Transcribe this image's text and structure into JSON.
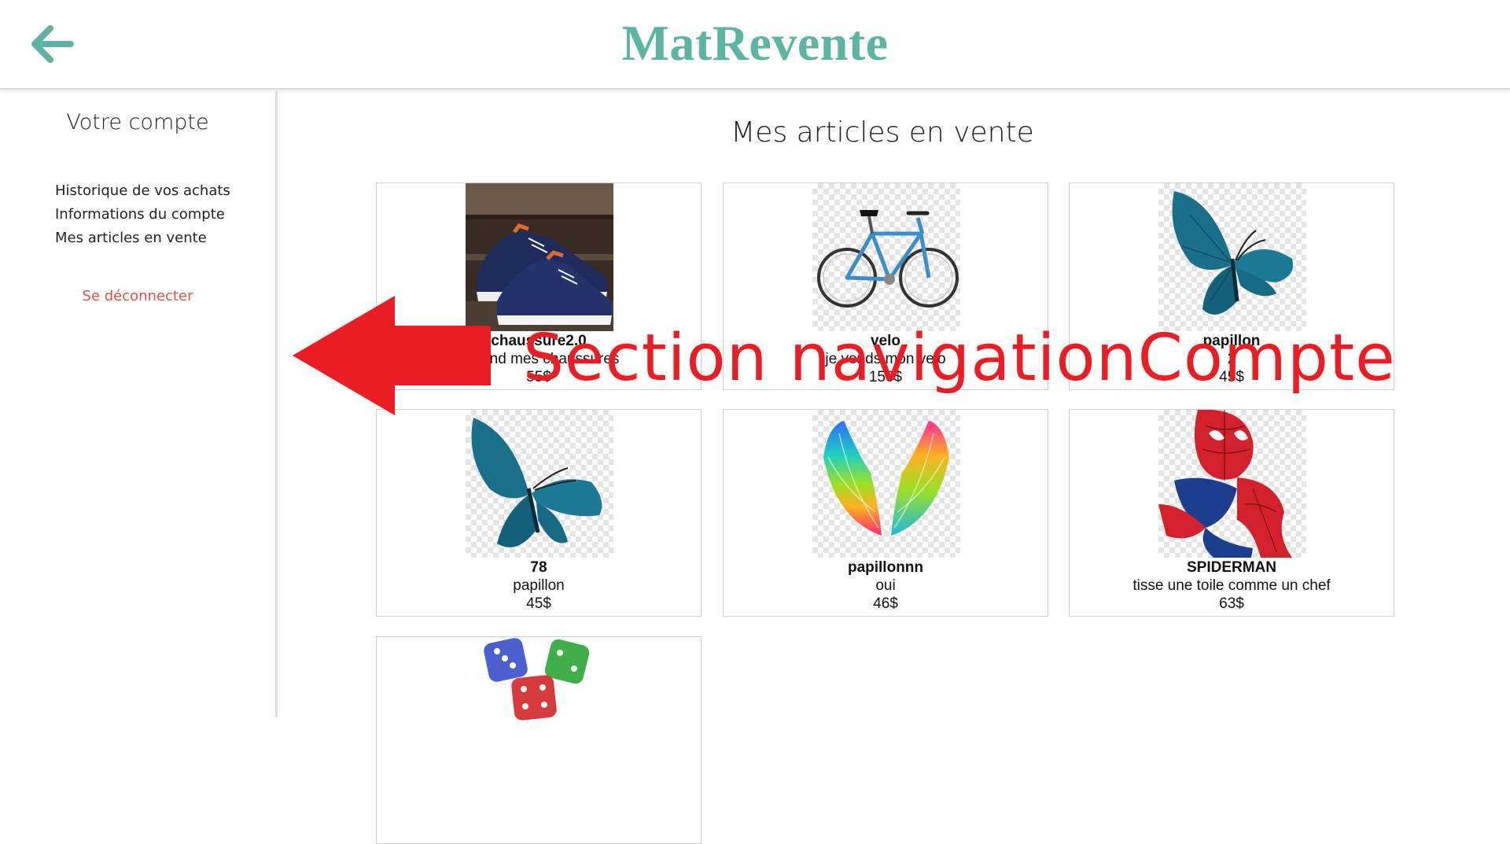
{
  "header": {
    "site_title": "MatRevente",
    "back_icon": "arrow-left-icon",
    "accent_color": "#5bb5a2"
  },
  "sidebar": {
    "title": "Votre compte",
    "items": [
      {
        "label": "Historique de vos achats"
      },
      {
        "label": "Informations du compte"
      },
      {
        "label": "Mes articles en vente"
      }
    ],
    "logout_label": "Se déconnecter",
    "logout_color": "#d9534f"
  },
  "main": {
    "title": "Mes articles en vente",
    "articles": [
      {
        "name": "chaussure2.0",
        "description": "je vend mes chaussures",
        "price": "55$",
        "image": "sneaker-image"
      },
      {
        "name": "velo",
        "description": "je vends mon velo",
        "price": "150$",
        "image": "bicycle-image"
      },
      {
        "name": "papillon",
        "description": "2",
        "price": "45$",
        "image": "butterfly-image"
      },
      {
        "name": "78",
        "description": "papillon",
        "price": "45$",
        "image": "butterfly-image"
      },
      {
        "name": "papillonnn",
        "description": "oui",
        "price": "46$",
        "image": "rainbow-wings-image"
      },
      {
        "name": "SPIDERMAN",
        "description": "tisse une toile comme un chef",
        "price": "63$",
        "image": "spiderman-image"
      },
      {
        "name": "",
        "description": "",
        "price": "",
        "image": "dice-image"
      }
    ]
  },
  "annotation": {
    "text": "Section navigationCompte",
    "color": "#ec1c24",
    "icon": "arrow-left-big-icon"
  }
}
